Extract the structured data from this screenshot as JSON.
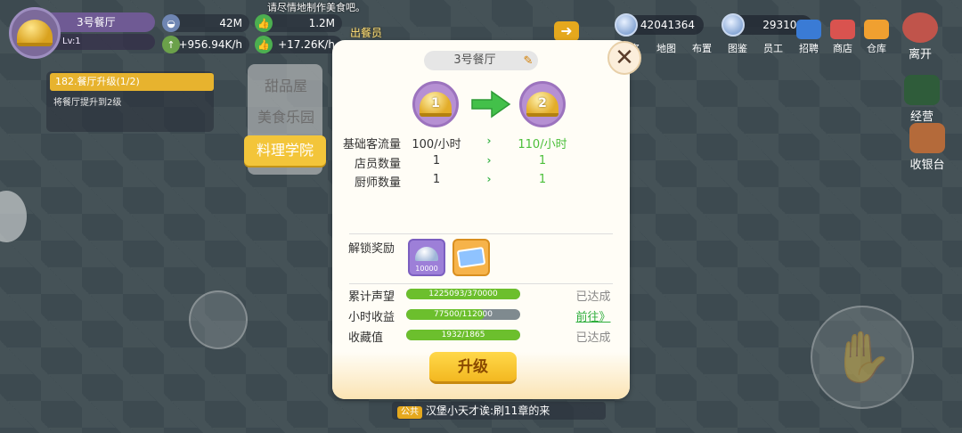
{
  "player": {
    "restaurant_name": "3号餐厅",
    "level": "Lv:1"
  },
  "resources": {
    "left": [
      {
        "icon": "dish-icon",
        "value": "42M",
        "rate": "+956.94K/h"
      },
      {
        "icon": "thumb-up-icon",
        "value": "1.2M",
        "rate": "+17.26K/h"
      }
    ]
  },
  "notice": "请尽情地制作美食吧。",
  "deliver_label": "出餐员",
  "task": {
    "title": "182.餐厅升级(1/2)",
    "desc": "将餐厅提升到2级"
  },
  "currencies": [
    {
      "icon": "silver-dish-icon",
      "value": "42041364"
    },
    {
      "icon": "star-coin-icon",
      "value": "293100"
    }
  ],
  "top_menu": [
    "排名",
    "地图",
    "布置",
    "图鉴",
    "员工",
    "招聘",
    "商店",
    "仓库"
  ],
  "side_menu": [
    {
      "label": "离开",
      "icon": "exit-door-icon"
    },
    {
      "label": "经营",
      "icon": "chalkboard-icon"
    },
    {
      "label": "收银台",
      "icon": "cash-register-icon"
    }
  ],
  "tabs": [
    {
      "label": "甜品屋",
      "active": false
    },
    {
      "label": "美食乐园",
      "active": false
    },
    {
      "label": "料理学院",
      "active": true
    }
  ],
  "dialog": {
    "title": "3号餐厅",
    "from_level": "1",
    "to_level": "2",
    "stats": [
      {
        "label": "基础客流量",
        "old": "100/小时",
        "new": "110/小时"
      },
      {
        "label": "店员数量",
        "old": "1",
        "new": "1"
      },
      {
        "label": "厨师数量",
        "old": "1",
        "new": "1"
      }
    ],
    "reward_label": "解锁奖励",
    "rewards": [
      {
        "icon": "silver-dish-icon",
        "count": "10000",
        "color": "#9d7fd8"
      },
      {
        "icon": "ticket-card-icon",
        "count": "",
        "color": "#f6b34a"
      }
    ],
    "requirements": [
      {
        "label": "累计声望",
        "text": "1225093/370000",
        "progress": 1.0,
        "status": "已达成",
        "is_link": false
      },
      {
        "label": "小时收益",
        "text": "77500/112000",
        "progress": 0.69,
        "status": "前往》",
        "is_link": true
      },
      {
        "label": "收藏值",
        "text": "1932/1865",
        "progress": 1.0,
        "status": "已达成",
        "is_link": false
      }
    ],
    "upgrade_label": "升级"
  },
  "chat": {
    "tag": "公共",
    "message": "汉堡小天才诶:刷11章的来"
  },
  "colors": {
    "accent": "#f3c53a",
    "success": "#4bbf3a",
    "progress_fill": "#6cbf2d"
  }
}
